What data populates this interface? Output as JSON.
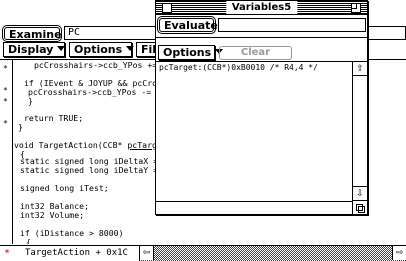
{
  "toolbar": {
    "examine_label": "Examine",
    "address_value": "PC",
    "display_label": "Display",
    "options_label": "Options",
    "file_label": "File"
  },
  "code_lines": [
    "pcCrosshairs->ccb_YPos +=",
    "",
    "if (IEvent & JOYUP && pcCros",
    "pcCrosshairs->ccb_YPos -=",
    "}",
    "",
    "return TRUE;",
    "}",
    "",
    "void TargetAction(CCB* ",
    "{",
    "static signed long iDeltaX =",
    "static signed long iDeltaY =",
    "",
    "signed long iTest;",
    "",
    "int32 Balance;",
    "int32 Volume;",
    "",
    "if (iDistance > 8000)",
    "{"
  ],
  "code_underlined": "pcTarge",
  "breakpoint_marks": [
    "*",
    "*",
    "*",
    "*"
  ],
  "status": {
    "marker": "*",
    "function_label": "TargetAction + 0x1C",
    "left_arrow": "⇦",
    "right_arrow": "⇨"
  },
  "variables_window": {
    "title": "Variables5",
    "evaluate_label": "Evaluate",
    "expression_value": "",
    "options_label": "Options",
    "clear_label": "Clear",
    "output_line": "pcTarget:(CCB*)0xB0010 /* R4,4 */",
    "up_arrow": "⇧",
    "down_arrow": "⇩"
  },
  "colors": {
    "status_marker": "#d00000",
    "disabled": "#999999"
  }
}
